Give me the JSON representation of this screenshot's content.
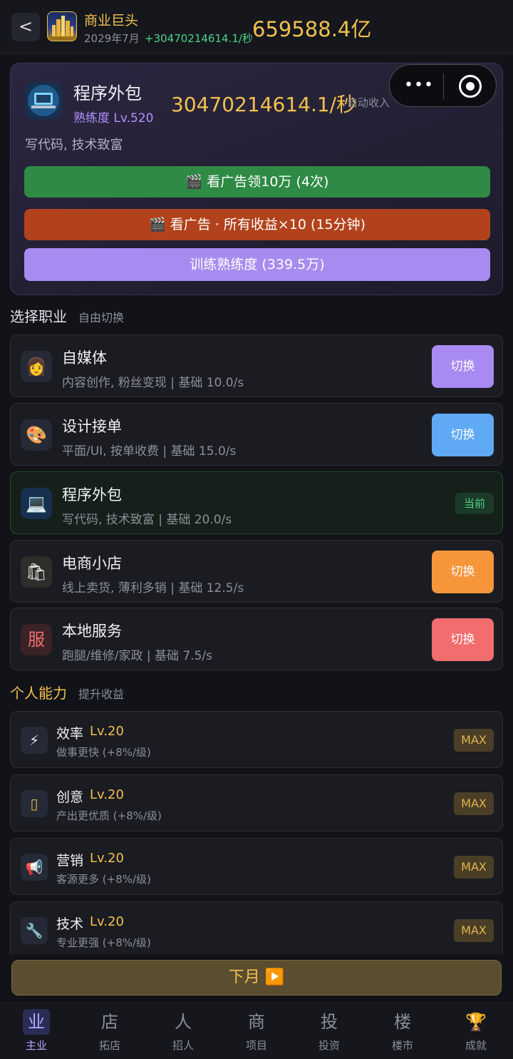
{
  "header": {
    "back_label": "<",
    "title": "商业巨头",
    "date": "2029年7月",
    "rate": "+30470214614.1/秒",
    "money": "659588.4亿"
  },
  "capsule": {
    "more_label": "•••"
  },
  "hero": {
    "name": "程序外包",
    "level": "熟练度 Lv.520",
    "income": "30470214614.1/秒",
    "auto_label": "自动收入",
    "desc": "写代码, 技术致富",
    "btn_ad_cash": "🎬 看广告领10万 (4次)",
    "btn_ad_boost": "🎬 看广告 · 所有收益×10 (15分钟)",
    "btn_train": "训练熟练度 (339.5万)"
  },
  "careers_section": {
    "title": "选择职业",
    "subtitle": "自由切换"
  },
  "careers": [
    {
      "name": "自媒体",
      "desc": "内容创作, 粉丝变现 | 基础 10.0/s",
      "action": "切换",
      "color": "#a98af2",
      "icon": "👩"
    },
    {
      "name": "设计接单",
      "desc": "平面/UI, 按单收费 | 基础 15.0/s",
      "action": "切换",
      "color": "#5fa9f5",
      "icon": "🎨"
    },
    {
      "name": "程序外包",
      "desc": "写代码, 技术致富 | 基础 20.0/s",
      "action": "当前",
      "color": "#4fd287",
      "icon": "💻"
    },
    {
      "name": "电商小店",
      "desc": "线上卖货, 薄利多销 | 基础 12.5/s",
      "action": "切换",
      "color": "#f7953a",
      "icon": "🛍"
    },
    {
      "name": "本地服务",
      "desc": "跑腿/维修/家政 | 基础 7.5/s",
      "action": "切换",
      "color": "#f26d6d",
      "icon": "服"
    }
  ],
  "abilities_section": {
    "title": "个人能力",
    "subtitle": "提升收益"
  },
  "abilities": [
    {
      "name": "效率",
      "level": "Lv.20",
      "desc": "做事更快 (+8%/级)",
      "badge": "MAX",
      "icon": "⚡"
    },
    {
      "name": "创意",
      "level": "Lv.20",
      "desc": "产出更优质 (+8%/级)",
      "badge": "MAX",
      "icon": "▯"
    },
    {
      "name": "营销",
      "level": "Lv.20",
      "desc": "客源更多 (+8%/级)",
      "badge": "MAX",
      "icon": "📢"
    },
    {
      "name": "技术",
      "level": "Lv.20",
      "desc": "专业更强 (+8%/级)",
      "badge": "MAX",
      "icon": "🔧"
    }
  ],
  "next_month": "下月 ▶️",
  "nav": [
    {
      "icon": "业",
      "label": "主业"
    },
    {
      "icon": "店",
      "label": "拓店"
    },
    {
      "icon": "人",
      "label": "招人"
    },
    {
      "icon": "商",
      "label": "项目"
    },
    {
      "icon": "投",
      "label": "投资"
    },
    {
      "icon": "楼",
      "label": "楼市"
    },
    {
      "icon": "🏆",
      "label": "成就"
    }
  ],
  "colors": {
    "gold": "#f2c14e",
    "green": "#4fd287",
    "purple": "#b291ff",
    "btn_green": "#2f8a45",
    "btn_red": "#b2421c",
    "btn_purple": "#a88bf0"
  }
}
